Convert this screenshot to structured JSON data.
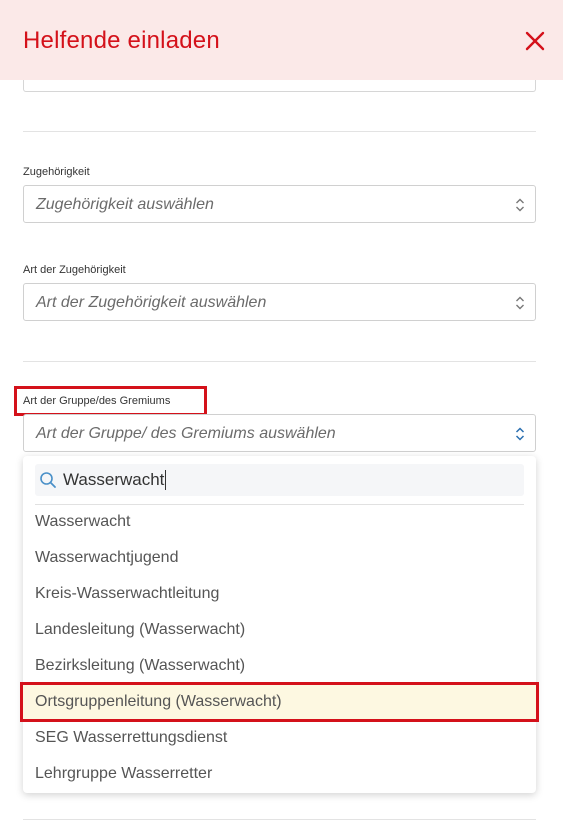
{
  "header": {
    "title": "Helfende einladen"
  },
  "fields": {
    "zugehoerigkeit": {
      "label": "Zugehörigkeit",
      "placeholder": "Zugehörigkeit auswählen"
    },
    "art_zugehoerigkeit": {
      "label": "Art der Zugehörigkeit",
      "placeholder": "Art der Zugehörigkeit auswählen"
    },
    "art_gruppe": {
      "label": "Art der Gruppe/des Gremiums",
      "placeholder": "Art der Gruppe/ des Gremiums auswählen"
    }
  },
  "dropdown": {
    "search_value": "Wasserwacht",
    "options": [
      "Wasserwacht",
      "Wasserwachtjugend",
      "Kreis-Wasserwachtleitung",
      "Landesleitung (Wasserwacht)",
      "Bezirksleitung (Wasserwacht)",
      "Ortsgruppenleitung (Wasserwacht)",
      "SEG Wasserrettungsdienst",
      "Lehrgruppe Wasserretter"
    ],
    "highlighted_option": "Ortsgruppenleitung (Wasserwacht)"
  },
  "colors": {
    "brand_red": "#d4111a",
    "header_bg": "#fbe9e8",
    "highlight_bg": "#fdf8e1"
  }
}
